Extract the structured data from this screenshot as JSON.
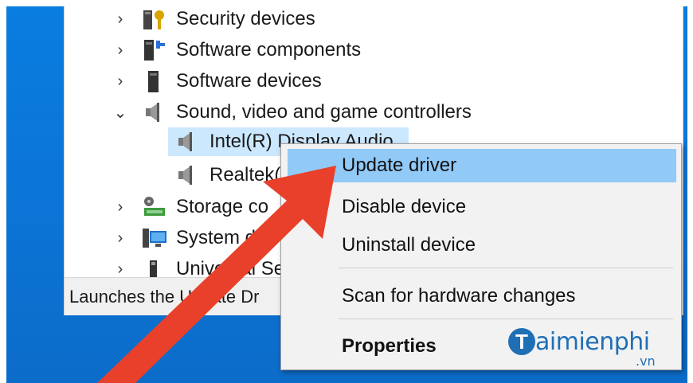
{
  "tree": {
    "items": [
      {
        "label": "Security devices",
        "icon": "security-key-icon",
        "chevron": "›",
        "indent": 0
      },
      {
        "label": "Software components",
        "icon": "software-component-icon",
        "chevron": "›",
        "indent": 0
      },
      {
        "label": "Software devices",
        "icon": "software-device-icon",
        "chevron": "›",
        "indent": 0
      },
      {
        "label": "Sound, video and game controllers",
        "icon": "speaker-icon",
        "chevron": "⌄",
        "indent": 0
      },
      {
        "label": "Intel(R) Display Audio",
        "icon": "speaker-icon",
        "chevron": "",
        "indent": 1,
        "selected": true
      },
      {
        "label": "Realtek(",
        "icon": "speaker-icon",
        "chevron": "",
        "indent": 1
      },
      {
        "label": "Storage co",
        "icon": "storage-controller-icon",
        "chevron": "›",
        "indent": 0
      },
      {
        "label": "System dev",
        "icon": "system-devices-icon",
        "chevron": "›",
        "indent": 0
      },
      {
        "label": "Universal Se",
        "icon": "usb-icon",
        "chevron": "›",
        "indent": 0
      }
    ]
  },
  "status_bar": {
    "text": "Launches the Update Dr"
  },
  "context_menu": {
    "items": [
      {
        "label": "Update driver",
        "highlighted": true
      },
      {
        "label": "Disable device"
      },
      {
        "label": "Uninstall device"
      },
      {
        "label": "Scan for hardware changes"
      },
      {
        "label": "Properties",
        "bold": true
      }
    ]
  },
  "watermark": {
    "letter": "T",
    "text": "aimienphi",
    "sub": ".vn"
  },
  "colors": {
    "desktop": "#0a7de0",
    "selection": "#cce8ff",
    "menu_highlight": "#91c9f7",
    "arrow": "#e8402a",
    "watermark": "#1f6fb5"
  }
}
